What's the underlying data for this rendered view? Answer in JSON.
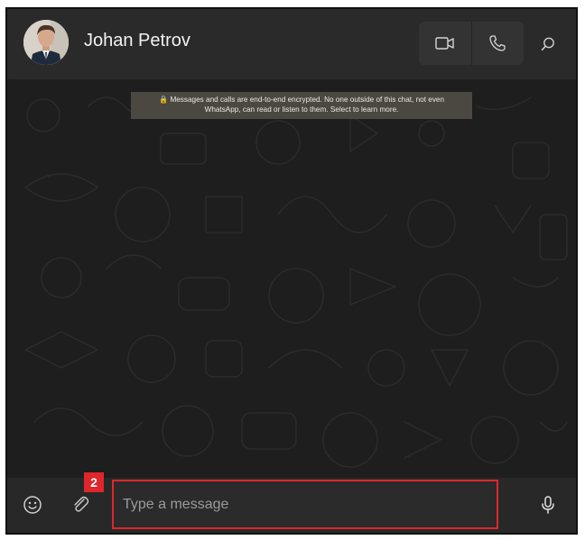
{
  "header": {
    "contact_name": "Johan Petrov",
    "avatar_icon": "contact-avatar",
    "video_call_icon": "video-camera-icon",
    "voice_call_icon": "phone-icon",
    "search_icon": "search-icon"
  },
  "chat": {
    "encryption_notice_line1": "🔒 Messages and calls are end-to-end encrypted. No one outside of this chat, not even",
    "encryption_notice_line2": "WhatsApp, can read or listen to them. Select to learn more."
  },
  "composer": {
    "emoji_icon": "emoji-icon",
    "attach_icon": "paperclip-icon",
    "placeholder": "Type a message",
    "mic_icon": "microphone-icon"
  },
  "annotation": {
    "step_number": "2",
    "highlight_color": "#e0262b"
  },
  "colors": {
    "header_bg": "#2a2a2a",
    "chat_bg": "#1e1e1e",
    "composer_bg": "#282828",
    "notice_bg": "#4a4840"
  }
}
